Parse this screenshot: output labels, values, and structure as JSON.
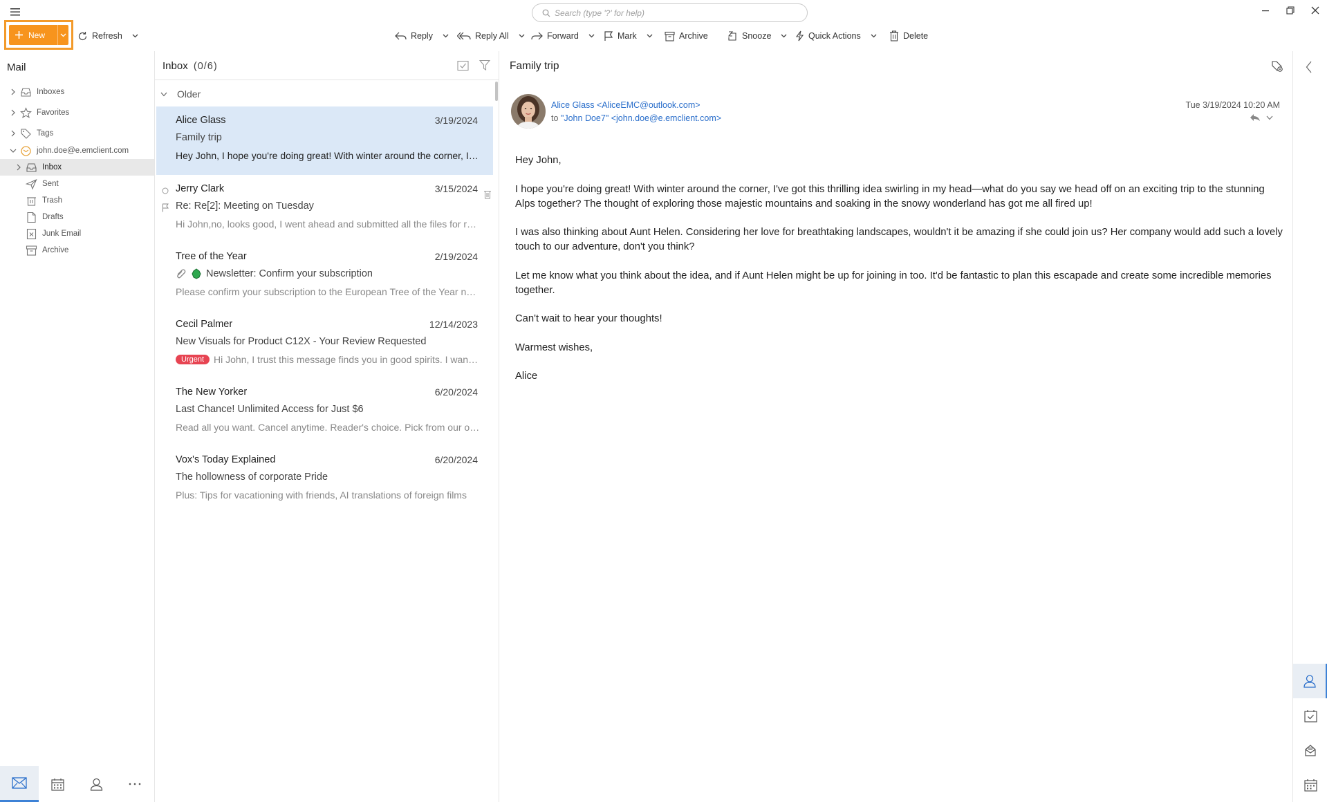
{
  "search": {
    "placeholder": "Search (type '?' for help)"
  },
  "toolbar": {
    "new_label": "New",
    "refresh_label": "Refresh",
    "reply_label": "Reply",
    "reply_all_label": "Reply All",
    "forward_label": "Forward",
    "mark_label": "Mark",
    "archive_label": "Archive",
    "snooze_label": "Snooze",
    "quick_actions_label": "Quick Actions",
    "delete_label": "Delete"
  },
  "sidebar": {
    "title": "Mail",
    "items": [
      {
        "label": "Inboxes",
        "icon": "inbox-icon"
      },
      {
        "label": "Favorites",
        "icon": "star-icon"
      },
      {
        "label": "Tags",
        "icon": "tag-icon"
      },
      {
        "label": "john.doe@e.emclient.com",
        "icon": "account-icon"
      },
      {
        "label": "Inbox",
        "icon": "inbox-icon"
      },
      {
        "label": "Sent",
        "icon": "send-icon"
      },
      {
        "label": "Trash",
        "icon": "trash-icon"
      },
      {
        "label": "Drafts",
        "icon": "draft-icon"
      },
      {
        "label": "Junk Email",
        "icon": "junk-icon"
      },
      {
        "label": "Archive",
        "icon": "archive-icon"
      }
    ],
    "bottom_nav": [
      "mail-icon",
      "calendar-icon",
      "contacts-icon",
      "more-icon"
    ]
  },
  "list": {
    "title": "Inbox",
    "count": "(0/6)",
    "group": "Older",
    "messages": [
      {
        "sender": "Alice Glass",
        "date": "3/19/2024",
        "subject": "Family trip",
        "preview": "Hey John, I hope you're doing great! With winter around the corner, I've got this thrilling idea"
      },
      {
        "sender": "Jerry Clark",
        "date": "3/15/2024",
        "subject": "Re: Re[2]: Meeting on Tuesday",
        "preview": "Hi John,no, looks good, I went ahead and submitted all the files for review"
      },
      {
        "sender": "Tree of the Year",
        "date": "2/19/2024",
        "subject": "Newsletter: Confirm your subscription",
        "preview": "Please confirm your subscription to the European Tree of the Year newsletter"
      },
      {
        "sender": "Cecil Palmer",
        "date": "12/14/2023",
        "subject": "New Visuals for Product C12X - Your Review Requested",
        "badge": "Urgent",
        "preview": "Hi John, I trust this message finds you in good spirits. I wanted to share"
      },
      {
        "sender": "The New Yorker",
        "date": "6/20/2024",
        "subject": "Last Chance! Unlimited Access for Just $6",
        "preview": "Read all you want. Cancel anytime. Reader's choice. Pick from our offers"
      },
      {
        "sender": "Vox's Today Explained",
        "date": "6/20/2024",
        "subject": "The hollowness of corporate Pride",
        "preview": "Plus: Tips for vacationing with friends, AI translations of foreign films"
      }
    ]
  },
  "reader": {
    "title": "Family trip",
    "from": "Alice Glass <AliceEMC@outlook.com>",
    "to_prefix": "to",
    "to": "\"John Doe7\" <john.doe@e.emclient.com>",
    "date": "Tue 3/19/2024 10:20 AM",
    "body": [
      "Hey John,",
      "I hope you're doing great! With winter around the corner, I've got this thrilling idea swirling in my head—what do you say we head off on an exciting trip to the stunning Alps together? The thought of exploring those majestic mountains and soaking in the snowy wonderland has got me all fired up!",
      "I was also thinking about Aunt Helen. Considering her love for breathtaking landscapes, wouldn't it be amazing if she could join us? Her company would add such a lovely touch to our adventure, don't you think?",
      "Let me know what you think about the idea, and if Aunt Helen might be up for joining in too. It'd be fantastic to plan this escapade and create some incredible memories together.",
      "Can't wait to hear your thoughts!",
      "Warmest wishes,",
      "Alice"
    ]
  },
  "rail": [
    "contacts-icon",
    "tasks-icon",
    "mail-tray-icon",
    "calendar-icon"
  ],
  "colors": {
    "accent": "#f7941d",
    "selection": "#dbe8f7",
    "link": "#2b6fcb",
    "urgent": "#e74452"
  }
}
